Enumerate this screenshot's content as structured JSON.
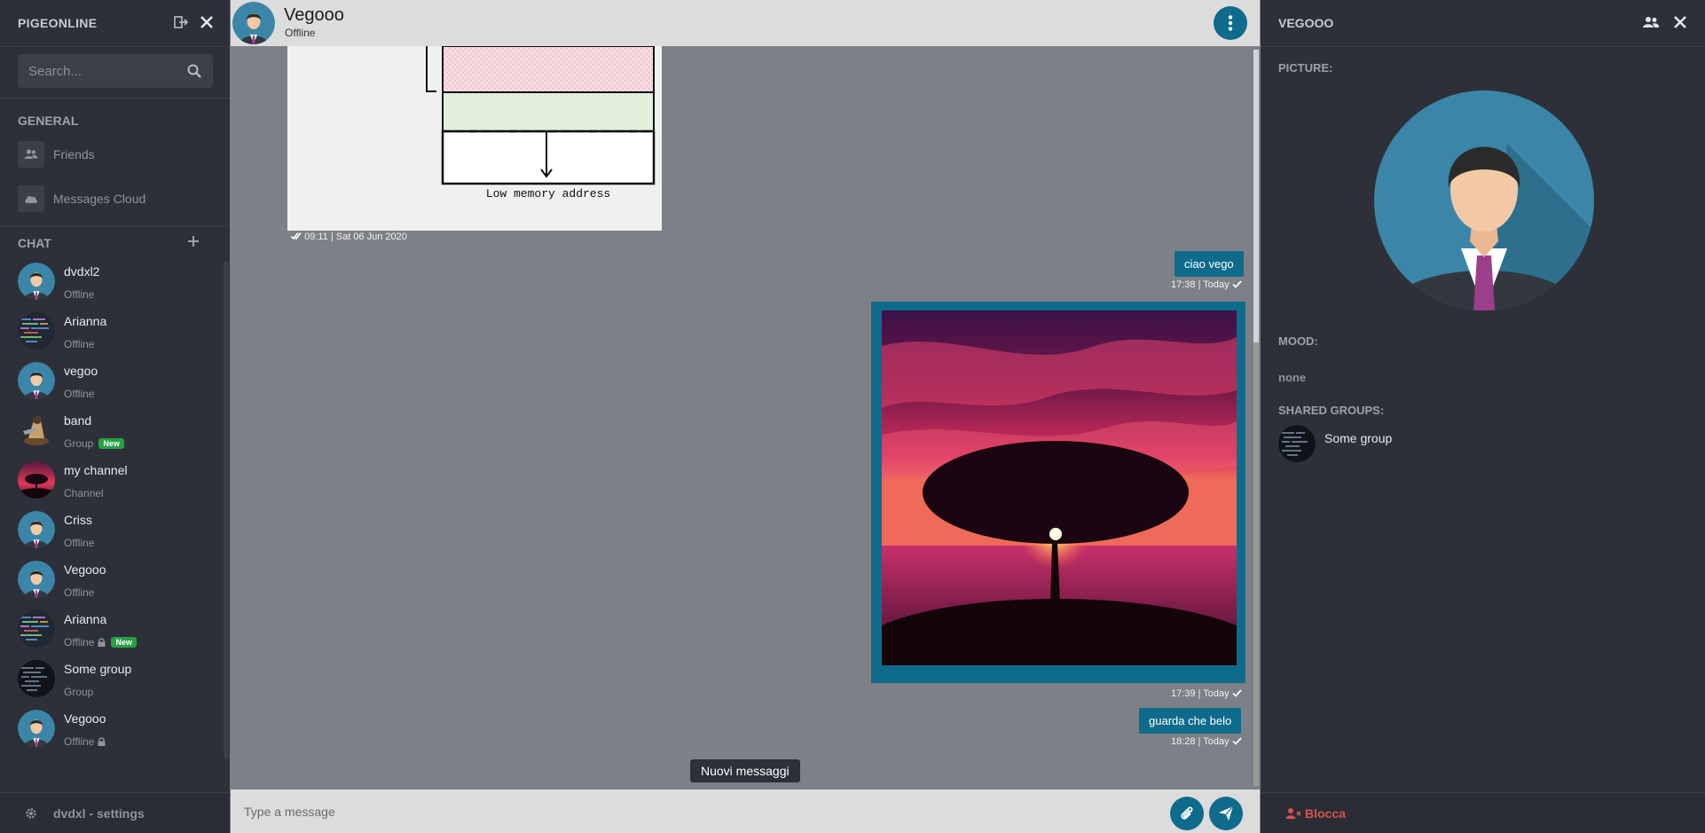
{
  "sidebar": {
    "brand": "PIGEONLINE",
    "search_placeholder": "Search...",
    "general_label": "GENERAL",
    "nav": [
      {
        "label": "Friends",
        "icon": "friends-icon"
      },
      {
        "label": "Messages Cloud",
        "icon": "cloud-icon"
      }
    ],
    "chat_label": "CHAT",
    "chats": [
      {
        "name": "dvdxl2",
        "status": "Offline",
        "avatar": "person",
        "new": false,
        "locked": false
      },
      {
        "name": "Arianna",
        "status": "Offline",
        "avatar": "code",
        "new": false,
        "locked": false
      },
      {
        "name": "vegoo",
        "status": "Offline",
        "avatar": "person",
        "new": false,
        "locked": false
      },
      {
        "name": "band",
        "status": "Group",
        "avatar": "band",
        "new": true,
        "locked": false
      },
      {
        "name": "my channel",
        "status": "Channel",
        "avatar": "sunset",
        "new": false,
        "locked": false
      },
      {
        "name": "Criss",
        "status": "Offline",
        "avatar": "person",
        "new": false,
        "locked": false
      },
      {
        "name": "Vegooo",
        "status": "Offline",
        "avatar": "person",
        "new": false,
        "locked": false
      },
      {
        "name": "Arianna",
        "status": "Offline",
        "avatar": "code",
        "new": true,
        "locked": true
      },
      {
        "name": "Some group",
        "status": "Group",
        "avatar": "code-dark",
        "new": false,
        "locked": false
      },
      {
        "name": "Vegooo",
        "status": "Offline",
        "avatar": "person",
        "new": false,
        "locked": true
      }
    ],
    "new_badge": "New",
    "footer": "dvdxl - settings"
  },
  "conversation": {
    "title": "Vegooo",
    "status": "Offline",
    "diagram_caption": "Low memory address",
    "messages": [
      {
        "meta": "09:11 | Sat 06 Jun 2020"
      },
      {
        "text": "ciao vego",
        "meta": "17:38 | Today"
      },
      {
        "image": "sunset-tree",
        "meta": "17:39 | Today"
      },
      {
        "text": "guarda che belo",
        "meta": "18:28 | Today"
      }
    ],
    "new_messages_toast": "Nuovi messaggi",
    "composer_placeholder": "Type a message"
  },
  "profile": {
    "title": "VEGOOO",
    "picture_label": "PICTURE:",
    "mood_label": "MOOD:",
    "mood_value": "none",
    "shared_groups_label": "SHARED GROUPS:",
    "shared_groups": [
      {
        "name": "Some group"
      }
    ],
    "block_label": "Blocca"
  },
  "colors": {
    "accent": "#0f6b8c",
    "sidebar_bg": "#2d3039",
    "chat_bg": "#7e8087",
    "new_badge": "#25a244",
    "danger": "#d9534f"
  }
}
